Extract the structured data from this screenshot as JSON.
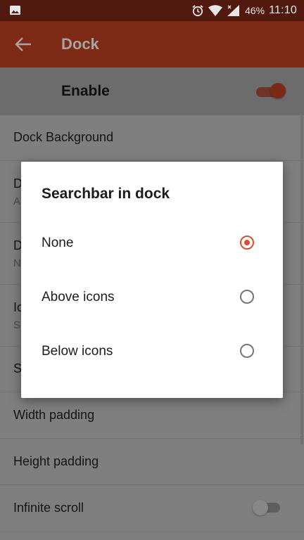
{
  "status_bar": {
    "battery": "46%",
    "time": "11:10",
    "icons": [
      "image-icon",
      "alarm-icon",
      "wifi-icon",
      "signal-icon"
    ]
  },
  "app_bar": {
    "title": "Dock",
    "back_icon": "arrow-back-icon"
  },
  "settings": {
    "enable": {
      "label": "Enable",
      "checked": true
    },
    "rows": [
      {
        "title": "Dock Background",
        "summary": ""
      },
      {
        "title": "D",
        "summary": "A"
      },
      {
        "title": "D",
        "summary": "N"
      },
      {
        "title": "Ic",
        "summary": "S"
      },
      {
        "title": "S",
        "summary": ""
      },
      {
        "title": "Width padding",
        "summary": ""
      },
      {
        "title": "Height padding",
        "summary": ""
      },
      {
        "title": "Infinite scroll",
        "summary": "",
        "switch_checked": false
      }
    ]
  },
  "dialog": {
    "title": "Searchbar in dock",
    "options": [
      {
        "label": "None",
        "selected": true
      },
      {
        "label": "Above icons",
        "selected": false
      },
      {
        "label": "Below icons",
        "selected": false
      }
    ]
  },
  "colors": {
    "status_bar": "#521a0f",
    "app_bar": "#7e2a17",
    "accent": "#dd4f2c",
    "scrim_background": "#7f7f7f"
  }
}
